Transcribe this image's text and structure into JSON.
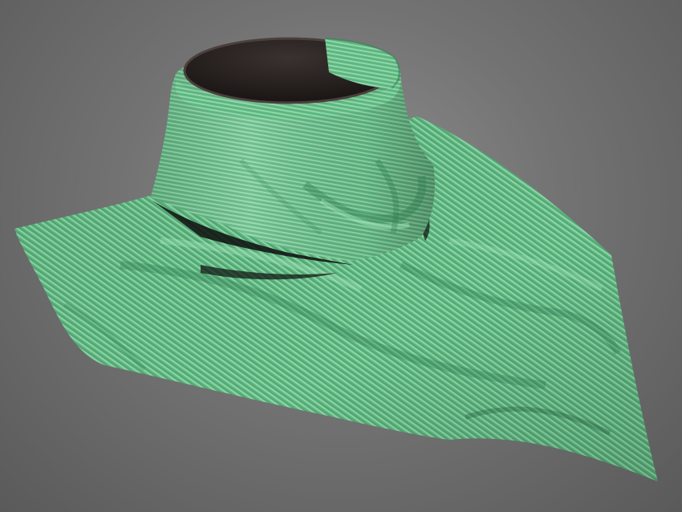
{
  "scene": {
    "subject": "green-knit-cloth-draped-over-cup",
    "colors": {
      "background_light": "#8e8e8e",
      "background_dark": "#5a5a5a",
      "fabric_base": "#5db67f",
      "fabric_highlight": "#9fe0b7",
      "fabric_shadow": "#2f7a4f",
      "cup_interior": "#2a2422",
      "cup_rim": "#4a403c",
      "cast_shadow": "#111111"
    }
  }
}
